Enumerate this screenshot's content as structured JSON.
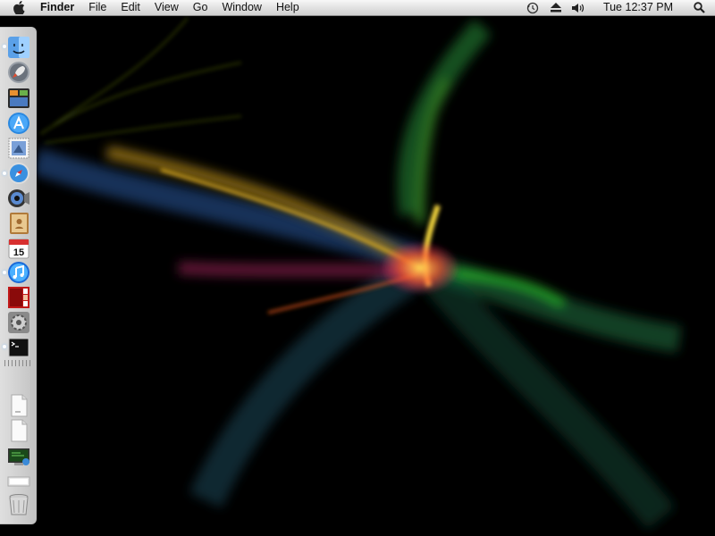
{
  "menubar": {
    "apple_icon": "apple-logo-icon",
    "app_name": "Finder",
    "menus": [
      "File",
      "Edit",
      "View",
      "Go",
      "Window",
      "Help"
    ],
    "status_icons": [
      "time-machine-icon",
      "eject-icon",
      "volume-icon"
    ],
    "clock": "Tue 12:37 PM",
    "spotlight_icon": "spotlight-search-icon"
  },
  "dock": {
    "position": "left",
    "apps": [
      {
        "name": "finder",
        "icon": "finder-icon",
        "running": true
      },
      {
        "name": "launchpad",
        "icon": "rocket-icon",
        "running": false
      },
      {
        "name": "mission-control",
        "icon": "mission-control-icon",
        "running": false
      },
      {
        "name": "app-store",
        "icon": "app-store-icon",
        "running": false
      },
      {
        "name": "mail",
        "icon": "mail-stamp-icon",
        "running": false
      },
      {
        "name": "safari",
        "icon": "safari-compass-icon",
        "running": true
      },
      {
        "name": "facetime",
        "icon": "facetime-camera-icon",
        "running": false
      },
      {
        "name": "address-book",
        "icon": "address-book-icon",
        "running": false
      },
      {
        "name": "ical",
        "icon": "calendar-icon",
        "running": false,
        "label": "15"
      },
      {
        "name": "itunes",
        "icon": "itunes-note-icon",
        "running": true
      },
      {
        "name": "photo-booth",
        "icon": "photo-booth-icon",
        "running": false
      },
      {
        "name": "system-preferences",
        "icon": "system-preferences-gear-icon",
        "running": false
      },
      {
        "name": "terminal",
        "icon": "terminal-icon",
        "running": true
      }
    ],
    "items": [
      {
        "name": "document-1",
        "icon": "document-icon"
      },
      {
        "name": "document-2",
        "icon": "document-icon"
      },
      {
        "name": "screen-sharing",
        "icon": "screen-sharing-icon"
      },
      {
        "name": "downloads-stack",
        "icon": "stack-folder-icon"
      },
      {
        "name": "trash",
        "icon": "trash-icon"
      }
    ]
  },
  "colors": {
    "menubar_bg": "#e4e4e4",
    "desktop_bg": "#000000",
    "dock_bg": "#dcdcdc",
    "running_indicator": "#ffffff"
  }
}
